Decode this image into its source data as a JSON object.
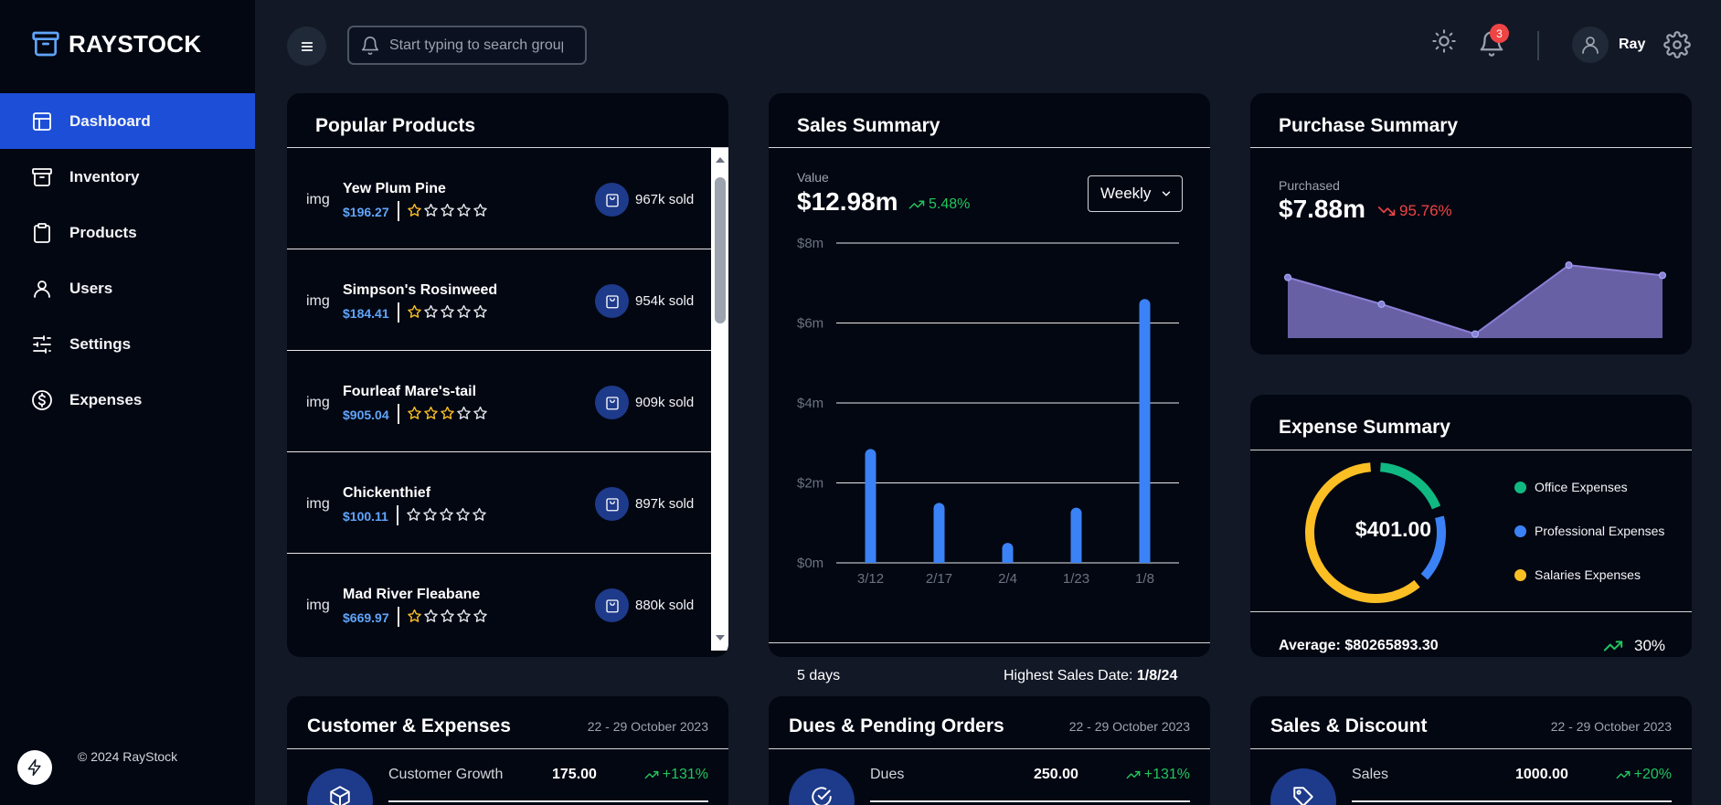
{
  "brand": {
    "name": "RAYSTOCK"
  },
  "nav": [
    {
      "label": "Dashboard",
      "icon": "layout-icon",
      "active": true
    },
    {
      "label": "Inventory",
      "icon": "archive-icon"
    },
    {
      "label": "Products",
      "icon": "clipboard-icon"
    },
    {
      "label": "Users",
      "icon": "user-icon"
    },
    {
      "label": "Settings",
      "icon": "sliders-icon"
    },
    {
      "label": "Expenses",
      "icon": "dollar-circle-icon"
    }
  ],
  "footer": {
    "copyright": "© 2024 RayStock"
  },
  "topbar": {
    "search_placeholder": "Start typing to search groups & products",
    "notification_count": "3",
    "username": "Ray"
  },
  "popular_products": {
    "title": "Popular Products",
    "items": [
      {
        "img": "img",
        "name": "Yew Plum Pine",
        "price": "$196.27",
        "rating": 1,
        "sold": "967k sold"
      },
      {
        "img": "img",
        "name": "Simpson's Rosinweed",
        "price": "$184.41",
        "rating": 1,
        "sold": "954k sold"
      },
      {
        "img": "img",
        "name": "Fourleaf Mare's-tail",
        "price": "$905.04",
        "rating": 3,
        "sold": "909k sold"
      },
      {
        "img": "img",
        "name": "Chickenthief",
        "price": "$100.11",
        "rating": 0,
        "sold": "897k sold"
      },
      {
        "img": "img",
        "name": "Mad River Fleabane",
        "price": "$669.97",
        "rating": 1,
        "sold": "880k sold"
      }
    ]
  },
  "sales_summary": {
    "title": "Sales Summary",
    "value_label": "Value",
    "value": "$12.98m",
    "change": "5.48%",
    "period": "Weekly",
    "footer_days": "5 days",
    "footer_highest_label": "Highest Sales Date: ",
    "footer_highest_value": "1/8/24"
  },
  "purchase_summary": {
    "title": "Purchase Summary",
    "label": "Purchased",
    "value": "$7.88m",
    "change": "95.76%"
  },
  "expense_summary": {
    "title": "Expense Summary",
    "total": "$401.00",
    "legend": [
      {
        "label": "Office Expenses",
        "color": "#10b981"
      },
      {
        "label": "Professional Expenses",
        "color": "#3b82f6"
      },
      {
        "label": "Salaries Expenses",
        "color": "#fbbf24"
      }
    ],
    "average_label": "Average: ",
    "average_value": "$80265893.30",
    "change": "30%"
  },
  "bottom_cards": [
    {
      "title": "Customer & Expenses",
      "date": "22 - 29 October 2023",
      "label": "Customer Growth",
      "value": "175.00",
      "change": "+131%",
      "icon": "box-icon"
    },
    {
      "title": "Dues & Pending Orders",
      "date": "22 - 29 October 2023",
      "label": "Dues",
      "value": "250.00",
      "change": "+131%",
      "icon": "check-circle-icon"
    },
    {
      "title": "Sales & Discount",
      "date": "22 - 29 October 2023",
      "label": "Sales",
      "value": "1000.00",
      "change": "+20%",
      "icon": "tag-icon"
    }
  ],
  "chart_data": [
    {
      "type": "bar",
      "title": "Sales Summary",
      "categories": [
        "3/12",
        "2/17",
        "2/4",
        "1/23",
        "1/8"
      ],
      "values": [
        2.85,
        1.5,
        0.5,
        1.38,
        6.6
      ],
      "y_ticks": [
        "$0m",
        "$2m",
        "$4m",
        "$6m",
        "$8m"
      ],
      "ylim": [
        0,
        8
      ],
      "grid": true,
      "color": "#3b82f6"
    },
    {
      "type": "area",
      "title": "Purchase Summary",
      "values": [
        5.9,
        3.3,
        0.4,
        7.1,
        6.1
      ],
      "ylim": [
        0,
        8
      ],
      "color": "#8b7fd6"
    },
    {
      "type": "pie",
      "title": "Expense Summary",
      "categories": [
        "Office Expenses",
        "Professional Expenses",
        "Salaries Expenses"
      ],
      "values": [
        80,
        72,
        249
      ]
    }
  ]
}
